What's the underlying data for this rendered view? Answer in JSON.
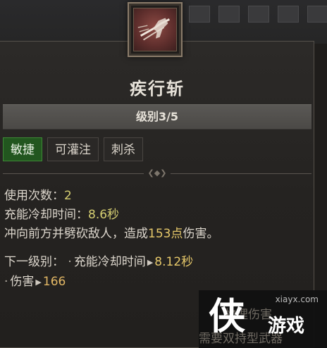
{
  "skill": {
    "name": "疾行斩",
    "level": "级别3/5",
    "tags": [
      "敏捷",
      "可灌注",
      "刺杀"
    ],
    "uses_label": "使用次数：",
    "uses_value": "2",
    "cooldown_label": "充能冷却时间：",
    "cooldown_value": "8.6秒",
    "desc_prefix": "冲向前方并劈砍敌人，造成",
    "desc_value": "153点",
    "desc_suffix": "伤害。",
    "next_label": "下一级别：",
    "next_cooldown_label": "充能冷却时间",
    "next_cooldown_value": "8.12秒",
    "next_damage_label": "伤害",
    "next_damage_value": "166",
    "faded_line1": "物理伤害",
    "faded_line2": "需要双持型武器"
  },
  "watermark": {
    "site": "xiayx.com",
    "logo_char": "侠",
    "logo_text": "游戏"
  },
  "colors": {
    "active_tag": "#22561f",
    "value_yellow": "#e6c86a",
    "panel_border": "#55504a"
  }
}
